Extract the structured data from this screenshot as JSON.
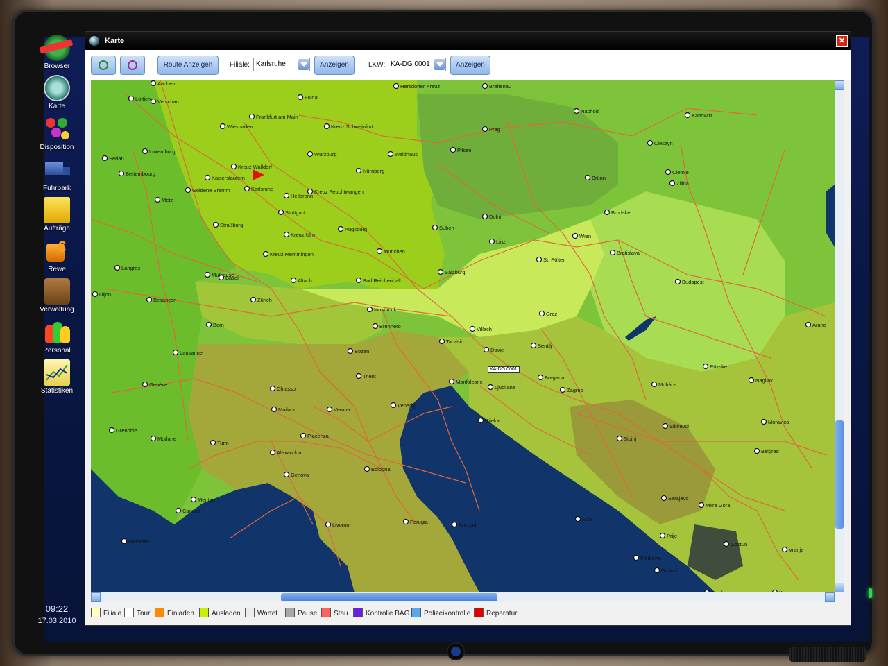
{
  "desktop": {
    "icons": [
      {
        "label": "Browser",
        "icon": "browser-icon"
      },
      {
        "label": "Karte",
        "icon": "compass-icon"
      },
      {
        "label": "Disposition",
        "icon": "disposition-icon"
      },
      {
        "label": "Fuhrpark",
        "icon": "truck-icon"
      },
      {
        "label": "Aufträge",
        "icon": "folder-icon"
      },
      {
        "label": "Rewe",
        "icon": "money-icon"
      },
      {
        "label": "Verwaltung",
        "icon": "briefcase-icon"
      },
      {
        "label": "Personal",
        "icon": "people-icon"
      },
      {
        "label": "Statistiken",
        "icon": "chart-icon"
      }
    ],
    "clock": {
      "time": "09:22",
      "date": "17.03.2010"
    }
  },
  "window": {
    "title": "Karte",
    "toolbar": {
      "zoom_in": "zoom-in-icon",
      "zoom_out": "zoom-out-icon",
      "route_button": "Route Anzeigen",
      "filiale_label": "Filiale:",
      "filiale_value": "Karlsruhe",
      "filiale_show": "Anzeigen",
      "lkw_label": "LKW:",
      "lkw_value": "KA-DG 0001",
      "lkw_show": "Anzeigen"
    },
    "legend": [
      {
        "label": "Filiale",
        "color": "#ffffc0"
      },
      {
        "label": "Tour",
        "color": "#ffffff"
      },
      {
        "label": "Einladen",
        "color": "#ff8a00"
      },
      {
        "label": "Ausladen",
        "color": "#c8f000"
      },
      {
        "label": "Wartet",
        "color": "#ececec"
      },
      {
        "label": "Pause",
        "color": "#a8a8a8"
      },
      {
        "label": "Stau",
        "color": "#ff6060"
      },
      {
        "label": "Kontrolle BAG",
        "color": "#6a20e0"
      },
      {
        "label": "Polizeikontrolle",
        "color": "#58a8f0"
      },
      {
        "label": "Reparatur",
        "color": "#e00000"
      }
    ],
    "truck_tag": "KA-DG 0001"
  },
  "map": {
    "cities": [
      "Aachen",
      "Lüttich",
      "Vetschau",
      "Fulda",
      "Hersdorfer Kreuz",
      "Breitenau",
      "Frankfurt am Main",
      "Wiesbaden",
      "Kreuz Schweinfurt",
      "Nachod",
      "Kattowitz",
      "Prag",
      "Pilsen",
      "Waidhaus",
      "Cieszyn",
      "Würzburg",
      "Nürnberg",
      "Sedan",
      "Luxemburg",
      "Kreuz Walldorf",
      "Bettembourg",
      "Kaiserslautern",
      "Goldene Bremm",
      "Karlsruhe",
      "Heilbronn",
      "Kreuz Feuchtwangen",
      "Brünn",
      "Ciernie",
      "Zilina",
      "Metz",
      "Stuttgart",
      "Straßburg",
      "Brodske",
      "Dolni",
      "Augsburg",
      "Suben",
      "Linz",
      "Kreuz Ulm",
      "München",
      "Wien",
      "Bratislava",
      "Kreuz Memmingen",
      "St. Pölten",
      "Salzburg",
      "Langres",
      "Mulhouse",
      "Basel",
      "Bad Reichenhall",
      "Altach",
      "Budapest",
      "Dijon",
      "Besançon",
      "Zürich",
      "Innsbruck",
      "Graz",
      "Brennero",
      "Bern",
      "Villach",
      "Arand",
      "Tarvisio",
      "Dovje",
      "Lausanne",
      "Sentilj",
      "Bozen",
      "Rözske",
      "Nagilak",
      "Trient",
      "Bregana",
      "Genève",
      "Monfalcone",
      "Ljubljana",
      "Zagreb",
      "Mohács",
      "Chiasso",
      "Mailand",
      "Verona",
      "Venedig",
      "Grenoble",
      "Modane",
      "Turin",
      "Piacenza",
      "Rijeka",
      "Moravica",
      "Sikirevci",
      "Sibinj",
      "Alexandria",
      "Belgrad",
      "Bologna",
      "Genova",
      "Sarajevo",
      "Mentan",
      "Cannes",
      "Mkra Gora",
      "Livorno",
      "Perugia",
      "Ancona",
      "Split",
      "Marseille",
      "Prije",
      "Gostun",
      "Vranje",
      "Metkovic",
      "Durinci",
      "Kopik",
      "Kumanovo"
    ]
  }
}
